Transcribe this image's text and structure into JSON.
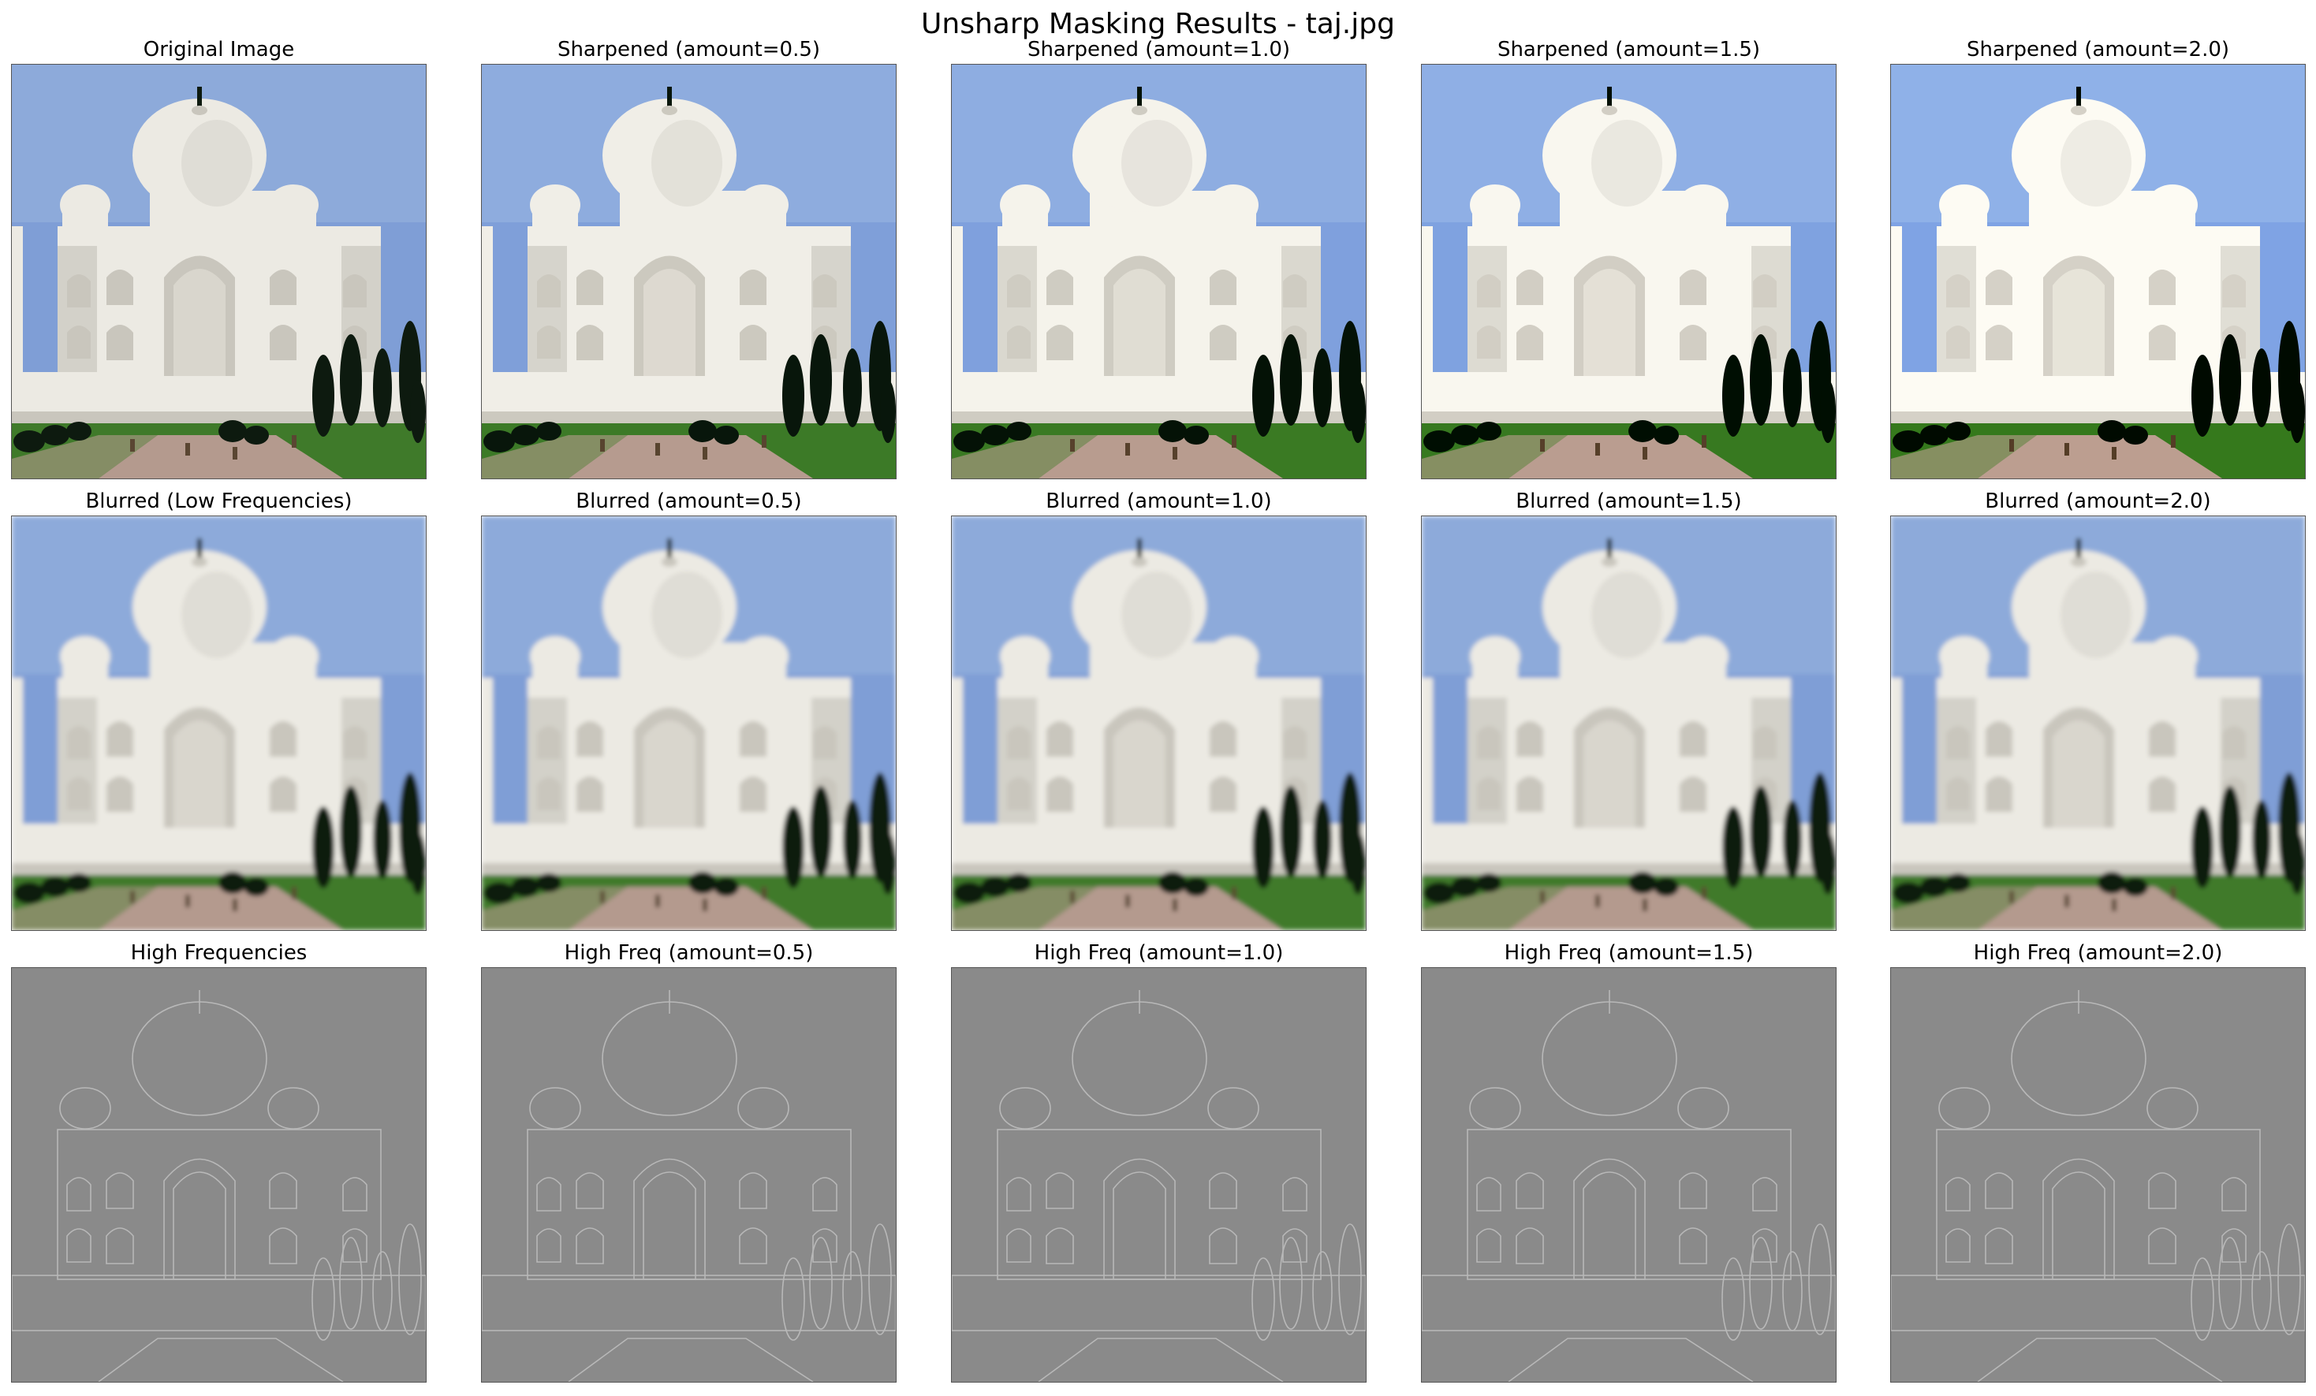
{
  "figure": {
    "title": "Unsharp Masking Results - taj.jpg"
  },
  "panels": [
    {
      "title": "Original Image",
      "variant": "sharp",
      "level": 0
    },
    {
      "title": "Sharpened (amount=0.5)",
      "variant": "sharp",
      "level": 0.5
    },
    {
      "title": "Sharpened (amount=1.0)",
      "variant": "sharp",
      "level": 1.0
    },
    {
      "title": "Sharpened (amount=1.5)",
      "variant": "sharp",
      "level": 1.5
    },
    {
      "title": "Sharpened (amount=2.0)",
      "variant": "sharp",
      "level": 2.0
    },
    {
      "title": "Blurred (Low Frequencies)",
      "variant": "blur",
      "level": 0
    },
    {
      "title": "Blurred (amount=0.5)",
      "variant": "blur",
      "level": 0.5
    },
    {
      "title": "Blurred (amount=1.0)",
      "variant": "blur",
      "level": 1.0
    },
    {
      "title": "Blurred (amount=1.5)",
      "variant": "blur",
      "level": 1.5
    },
    {
      "title": "Blurred (amount=2.0)",
      "variant": "blur",
      "level": 2.0
    },
    {
      "title": "High Frequencies",
      "variant": "high",
      "level": 0
    },
    {
      "title": "High Freq (amount=0.5)",
      "variant": "high",
      "level": 0.5
    },
    {
      "title": "High Freq (amount=1.0)",
      "variant": "high",
      "level": 1.0
    },
    {
      "title": "High Freq (amount=1.5)",
      "variant": "high",
      "level": 1.5
    },
    {
      "title": "High Freq (amount=2.0)",
      "variant": "high",
      "level": 2.0
    }
  ],
  "colors": {
    "sky": "#7f9ed6",
    "sky_light": "#a9bfe2",
    "marble": "#eceae3",
    "marble_shade": "#c9c6bd",
    "trees": "#0d1a0f",
    "lawn": "#3f7a2a",
    "path": "#b49a8e",
    "high_freq_gray": "#8a8a8a",
    "high_freq_line": "#b8b8b8"
  }
}
